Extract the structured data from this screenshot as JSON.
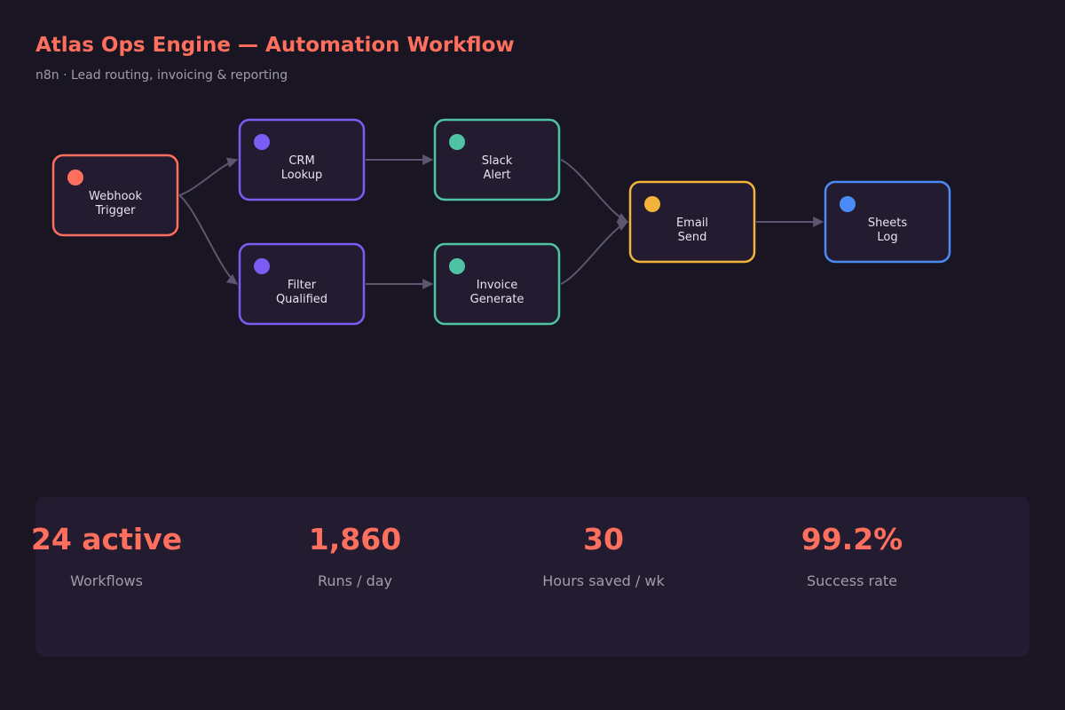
{
  "header": {
    "title": "Atlas Ops Engine — Automation Workflow",
    "subtitle": "n8n · Lead routing, invoicing & reporting"
  },
  "colors": {
    "accent": "#fe6f5e",
    "trigger": "#fe6f5e",
    "crm": "#7b5cf5",
    "notify": "#4fc4a4",
    "email": "#f4b43c",
    "sheets": "#4a8cf7",
    "edge": "#5c5670"
  },
  "workflow": {
    "nodes": [
      {
        "id": "webhook",
        "line1": "Webhook",
        "line2": "Trigger",
        "color": "#fe6f5e"
      },
      {
        "id": "crm",
        "line1": "CRM",
        "line2": "Lookup",
        "color": "#7b5cf5"
      },
      {
        "id": "filter",
        "line1": "Filter",
        "line2": "Qualified",
        "color": "#7b5cf5"
      },
      {
        "id": "slack",
        "line1": "Slack",
        "line2": "Alert",
        "color": "#4fc4a4"
      },
      {
        "id": "invoice",
        "line1": "Invoice",
        "line2": "Generate",
        "color": "#4fc4a4"
      },
      {
        "id": "email",
        "line1": "Email",
        "line2": "Send",
        "color": "#f4b43c"
      },
      {
        "id": "sheets",
        "line1": "Sheets",
        "line2": "Log",
        "color": "#4a8cf7"
      }
    ],
    "edges": [
      {
        "from": "webhook",
        "to": "crm"
      },
      {
        "from": "webhook",
        "to": "filter"
      },
      {
        "from": "crm",
        "to": "slack"
      },
      {
        "from": "filter",
        "to": "invoice"
      },
      {
        "from": "slack",
        "to": "email"
      },
      {
        "from": "invoice",
        "to": "email"
      },
      {
        "from": "email",
        "to": "sheets"
      }
    ]
  },
  "stats": [
    {
      "value": "24 active",
      "label": "Workflows"
    },
    {
      "value": "1,860",
      "label": "Runs / day"
    },
    {
      "value": "30",
      "label": "Hours saved / wk"
    },
    {
      "value": "99.2%",
      "label": "Success rate"
    }
  ]
}
